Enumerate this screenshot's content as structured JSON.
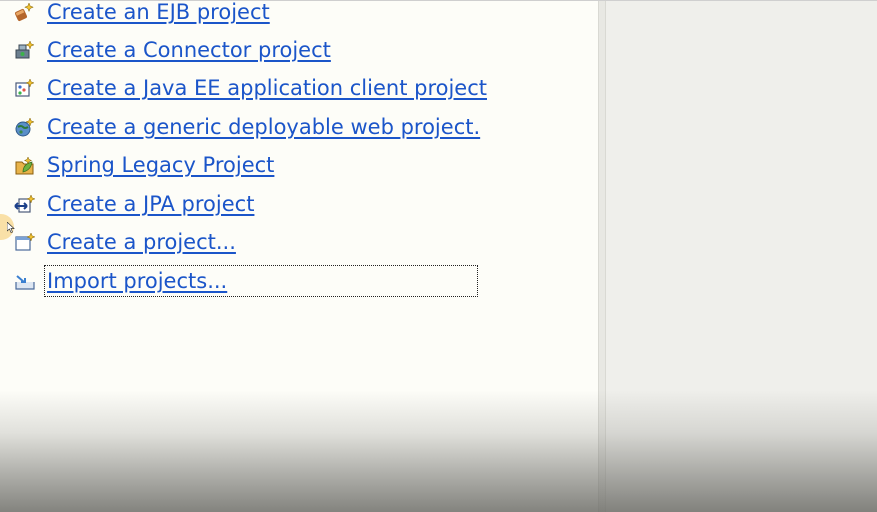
{
  "actions": [
    {
      "label": "Create an EJB project",
      "icon": "ejb-project-icon"
    },
    {
      "label": "Create a Connector project",
      "icon": "connector-project-icon"
    },
    {
      "label": "Create a Java EE application client project",
      "icon": "app-client-project-icon"
    },
    {
      "label": "Create a generic deployable web project.",
      "icon": "web-project-icon"
    },
    {
      "label": "Spring Legacy Project",
      "icon": "spring-project-icon"
    },
    {
      "label": "Create a JPA project",
      "icon": "jpa-project-icon"
    },
    {
      "label": "Create a project...",
      "icon": "new-project-icon"
    },
    {
      "label": "Import projects...",
      "icon": "import-projects-icon"
    }
  ],
  "colors": {
    "link": "#1b55c9",
    "background": "#fdfdf8",
    "right_pane": "#efefeb"
  }
}
